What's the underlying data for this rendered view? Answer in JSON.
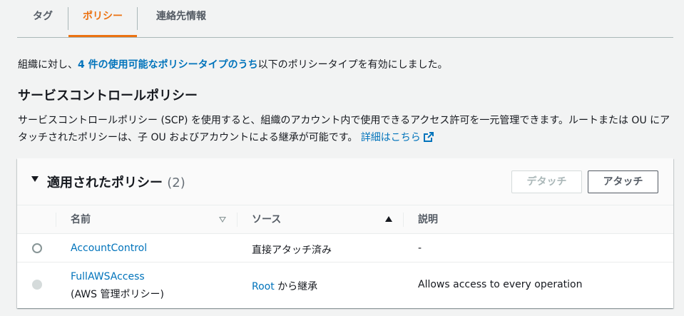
{
  "tabs": [
    {
      "label": "タグ"
    },
    {
      "label": "ポリシー"
    },
    {
      "label": "連絡先情報"
    }
  ],
  "intro": {
    "prefix": "組織に対し、",
    "link": "4 件の使用可能なポリシータイプのうち",
    "suffix": "以下のポリシータイプを有効にしました。"
  },
  "section": {
    "title": "サービスコントロールポリシー",
    "description": "サービスコントロールポリシー (SCP) を使用すると、組織のアカウント内で使用できるアクセス許可を一元管理できます。ルートまたは OU にアタッチされたポリシーは、子 OU およびアカウントによる継承が可能です。",
    "learn_more": "詳細はこちら"
  },
  "panel": {
    "title": "適用されたポリシー",
    "count": "(2)",
    "detach_label": "デタッチ",
    "attach_label": "アタッチ",
    "columns": [
      "名前",
      "ソース",
      "説明"
    ],
    "rows": [
      {
        "name": "AccountControl",
        "name_sub": "",
        "source_link": "",
        "source_text": "直接アタッチ済み",
        "description": "-"
      },
      {
        "name": "FullAWSAccess",
        "name_sub": "(AWS 管理ポリシー)",
        "source_link": "Root",
        "source_text": " から継承",
        "description": "Allows access to every operation"
      }
    ]
  },
  "colors": {
    "accent": "#ec7211",
    "link": "#0073bb"
  }
}
